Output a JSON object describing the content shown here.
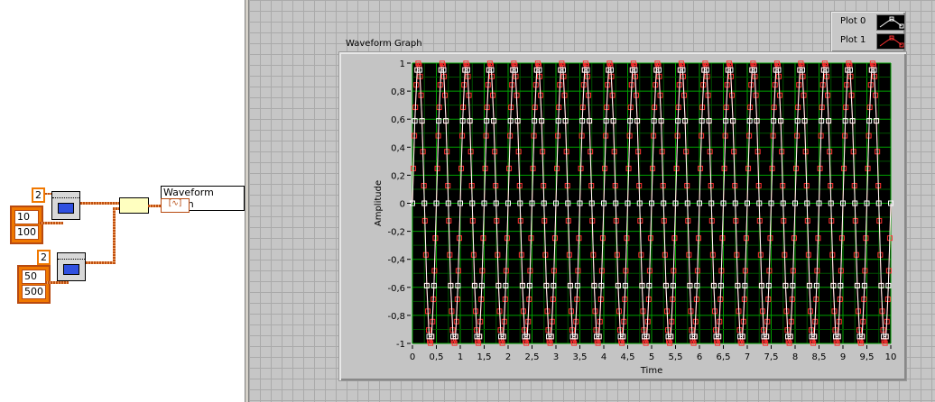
{
  "block_diagram": {
    "sine1": {
      "const": "2",
      "frequency": "10",
      "samples": "100"
    },
    "sine2": {
      "const": "2",
      "frequency": "50",
      "samples": "500"
    },
    "indicator_label": "Waveform Graph"
  },
  "front_panel": {
    "graph_label": "Waveform Graph",
    "legend": [
      {
        "name": "Plot 0",
        "color": "#ffffff"
      },
      {
        "name": "Plot 1",
        "color": "#ff3030"
      }
    ]
  },
  "chart_data": {
    "type": "line",
    "title": "Waveform Graph",
    "xlabel": "Time",
    "ylabel": "Amplitude",
    "xlim": [
      0,
      10
    ],
    "ylim": [
      -1,
      1
    ],
    "xticks": [
      "0",
      "0,5",
      "1",
      "1,5",
      "2",
      "2,5",
      "3",
      "3,5",
      "4",
      "4,5",
      "5",
      "5,5",
      "6",
      "6,5",
      "7",
      "7,5",
      "8",
      "8,5",
      "9",
      "9,5",
      "10"
    ],
    "yticks": [
      "1",
      "0,8",
      "0,6",
      "0,4",
      "0,2",
      "0",
      "-0,2",
      "-0,4",
      "-0,6",
      "-0,8",
      "-1"
    ],
    "grid": true,
    "legend_position": "top-right",
    "series": [
      {
        "name": "Plot 0",
        "color": "#ffffff",
        "amplitude": 1,
        "frequency": 2,
        "dt": 0.05,
        "count": 201
      },
      {
        "name": "Plot 1",
        "color": "#ff3030",
        "amplitude": 1,
        "frequency": 2,
        "dt": 0.02,
        "count": 501
      }
    ]
  }
}
